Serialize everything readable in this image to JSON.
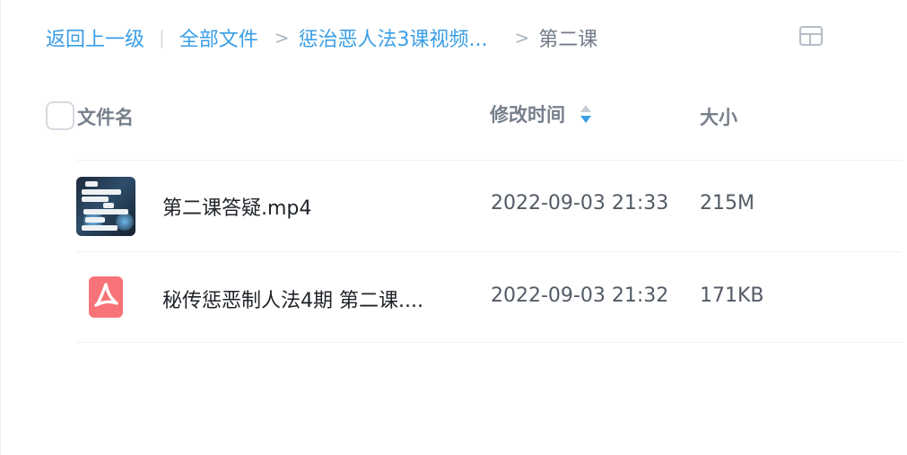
{
  "breadcrumb": {
    "back": "返回上一级",
    "separator": "|",
    "chevron": ">",
    "items": [
      "全部文件",
      "惩治恶人法3课视频...",
      "第二课"
    ]
  },
  "header": {
    "name": "文件名",
    "mtime": "修改时间",
    "size": "大小"
  },
  "files": [
    {
      "name": "第二课答疑.mp4",
      "mtime": "2022-09-03 21:33",
      "size": "215M",
      "type": "video"
    },
    {
      "name": "秘传惩恶制人法4期 第二课....",
      "mtime": "2022-09-03 21:32",
      "size": "171KB",
      "type": "pdf"
    }
  ],
  "colors": {
    "accent": "#3a9ee6",
    "pdf_icon": "#f87378",
    "muted_text": "#767f8b"
  },
  "icons": {
    "view_toggle": "grid-view-icon",
    "sort": "sort-icon",
    "pdf": "pdf-icon"
  }
}
